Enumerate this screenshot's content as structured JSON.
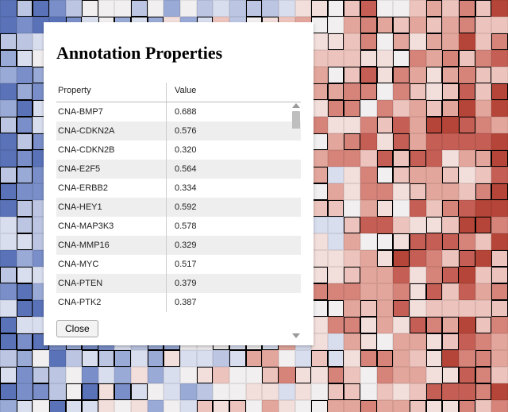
{
  "modal": {
    "title": "Annotation Properties",
    "columns": {
      "property": "Property",
      "value": "Value"
    },
    "close_label": "Close",
    "rows": [
      {
        "property": "CNA-BMP7",
        "value": "0.688"
      },
      {
        "property": "CNA-CDKN2A",
        "value": "0.576"
      },
      {
        "property": "CNA-CDKN2B",
        "value": "0.320"
      },
      {
        "property": "CNA-E2F5",
        "value": "0.564"
      },
      {
        "property": "CNA-ERBB2",
        "value": "0.334"
      },
      {
        "property": "CNA-HEY1",
        "value": "0.592"
      },
      {
        "property": "CNA-MAP3K3",
        "value": "0.578"
      },
      {
        "property": "CNA-MMP16",
        "value": "0.329"
      },
      {
        "property": "CNA-MYC",
        "value": "0.517"
      },
      {
        "property": "CNA-PTEN",
        "value": "0.379"
      },
      {
        "property": "CNA-PTK2",
        "value": "0.387"
      }
    ]
  },
  "heatmap": {
    "palette": [
      "#5a72b8",
      "#7a8fc9",
      "#9aaad6",
      "#bcc6e3",
      "#d9deef",
      "#f1eff0",
      "#f2dedb",
      "#edc4bd",
      "#e3a69c",
      "#d6847a",
      "#c55f55",
      "#b54538"
    ],
    "rows": 25,
    "cols": 31
  }
}
